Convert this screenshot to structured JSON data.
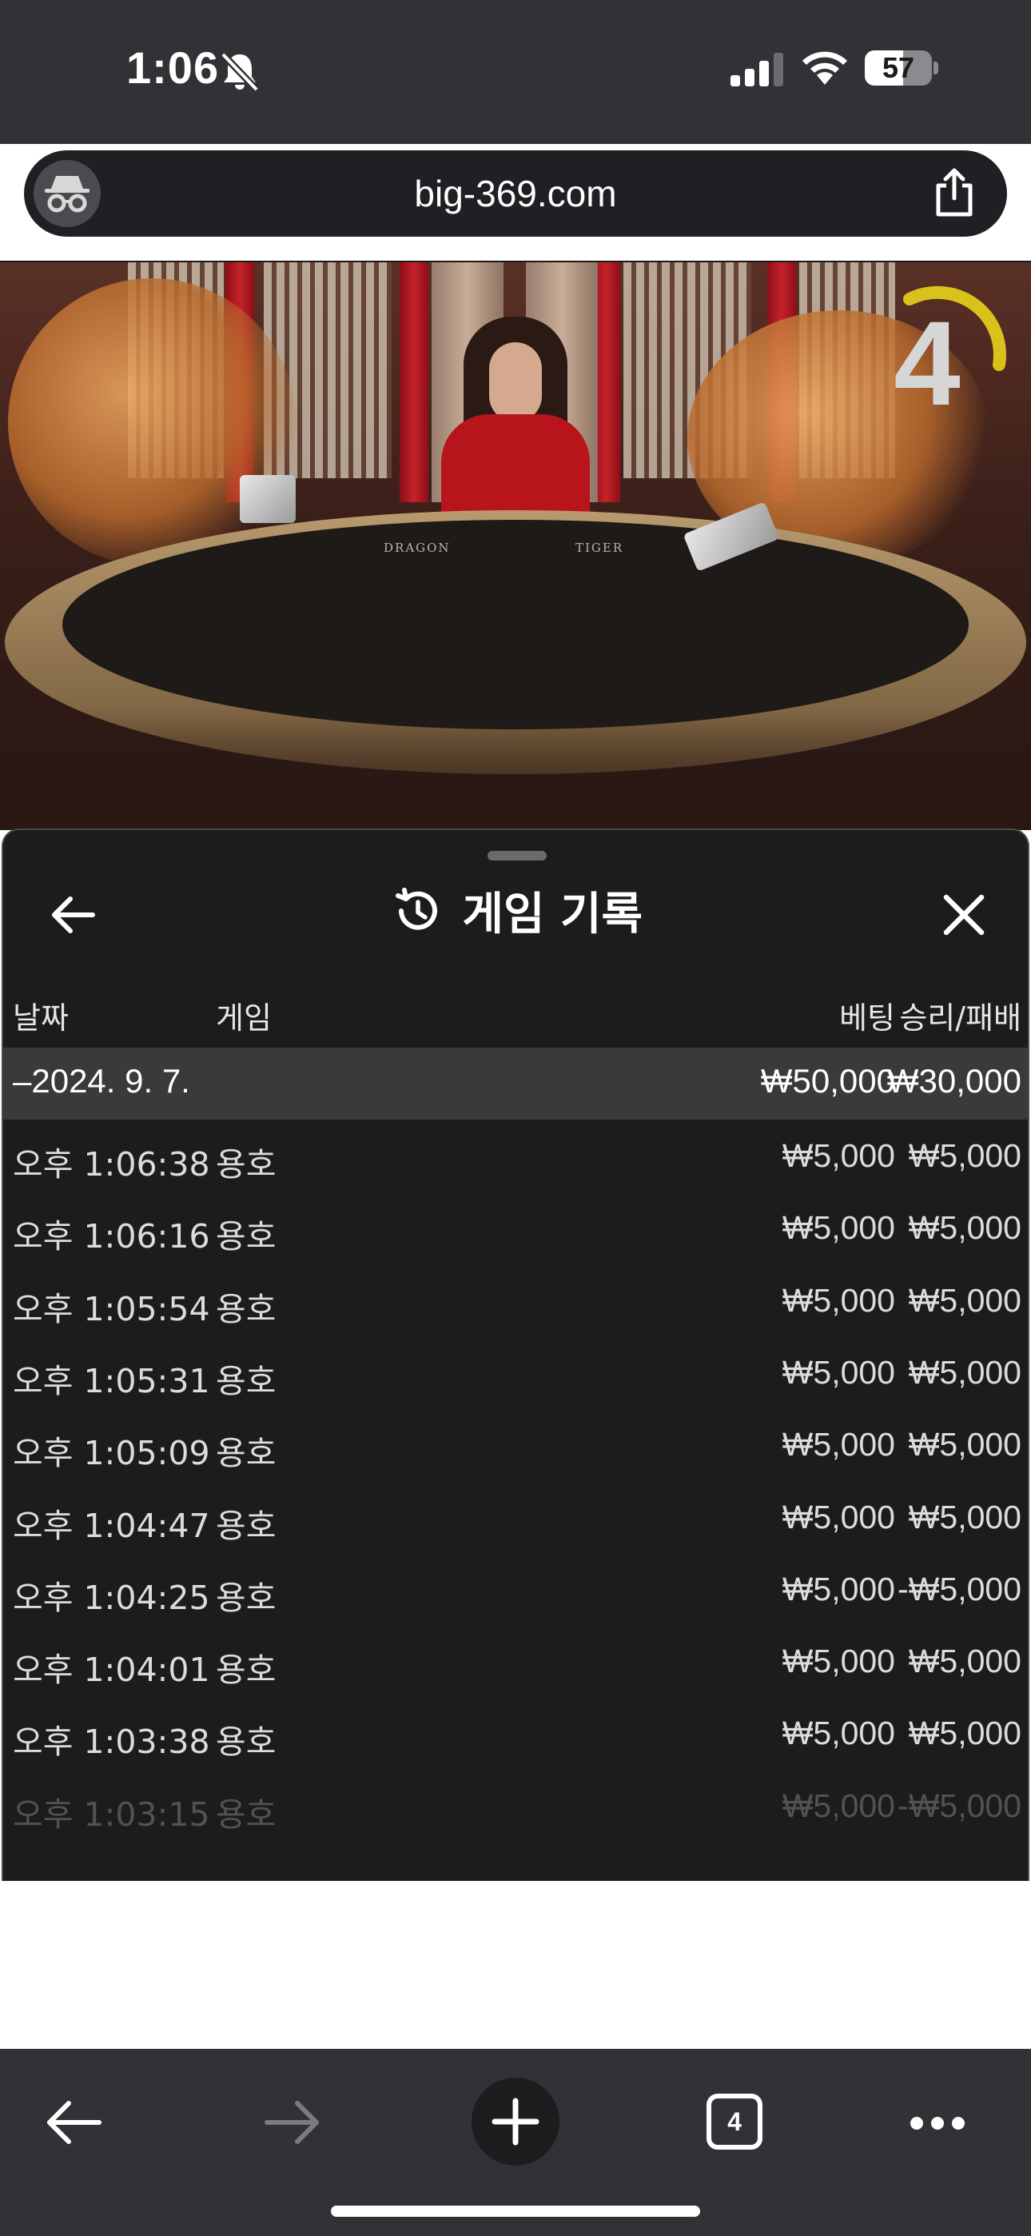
{
  "status_bar": {
    "time": "1:06",
    "battery": "57",
    "battery_level": 0.57
  },
  "browser": {
    "url": "big-369.com",
    "tab_count": "4"
  },
  "video": {
    "table_left_label": "DRAGON",
    "table_right_label": "TIGER",
    "countdown": "4"
  },
  "history": {
    "title": "게임 기록",
    "columns": {
      "date": "날짜",
      "game": "게임",
      "bet": "베팅",
      "result": "승리/패배"
    },
    "day_group": {
      "date": "–2024. 9. 7.",
      "bet": "₩50,000",
      "result": "₩30,000"
    },
    "rows": [
      {
        "time": "오후 1:06:38",
        "game": "용호",
        "bet": "₩5,000",
        "result": "₩5,000"
      },
      {
        "time": "오후 1:06:16",
        "game": "용호",
        "bet": "₩5,000",
        "result": "₩5,000"
      },
      {
        "time": "오후 1:05:54",
        "game": "용호",
        "bet": "₩5,000",
        "result": "₩5,000"
      },
      {
        "time": "오후 1:05:31",
        "game": "용호",
        "bet": "₩5,000",
        "result": "₩5,000"
      },
      {
        "time": "오후 1:05:09",
        "game": "용호",
        "bet": "₩5,000",
        "result": "₩5,000"
      },
      {
        "time": "오후 1:04:47",
        "game": "용호",
        "bet": "₩5,000",
        "result": "₩5,000"
      },
      {
        "time": "오후 1:04:25",
        "game": "용호",
        "bet": "₩5,000",
        "result": "-₩5,000"
      },
      {
        "time": "오후 1:04:01",
        "game": "용호",
        "bet": "₩5,000",
        "result": "₩5,000"
      },
      {
        "time": "오후 1:03:38",
        "game": "용호",
        "bet": "₩5,000",
        "result": "₩5,000"
      },
      {
        "time": "오후 1:03:15",
        "game": "용호",
        "bet": "₩5,000",
        "result": "-₩5,000"
      }
    ]
  },
  "icons": {
    "status": [
      "bell-slash-icon",
      "cellular-signal-icon",
      "wifi-icon",
      "battery-icon"
    ],
    "address_bar": [
      "incognito-icon",
      "share-icon"
    ],
    "sheet": [
      "back-arrow-icon",
      "history-clock-icon",
      "close-icon"
    ],
    "toolbar": [
      "back-arrow-icon",
      "forward-arrow-icon",
      "plus-icon",
      "tabs-icon",
      "more-icon"
    ]
  },
  "colors": {
    "sheet_bg": "#1c1c1c",
    "date_row_bg": "#3a3a3a",
    "chrome_bg": "#303235"
  }
}
